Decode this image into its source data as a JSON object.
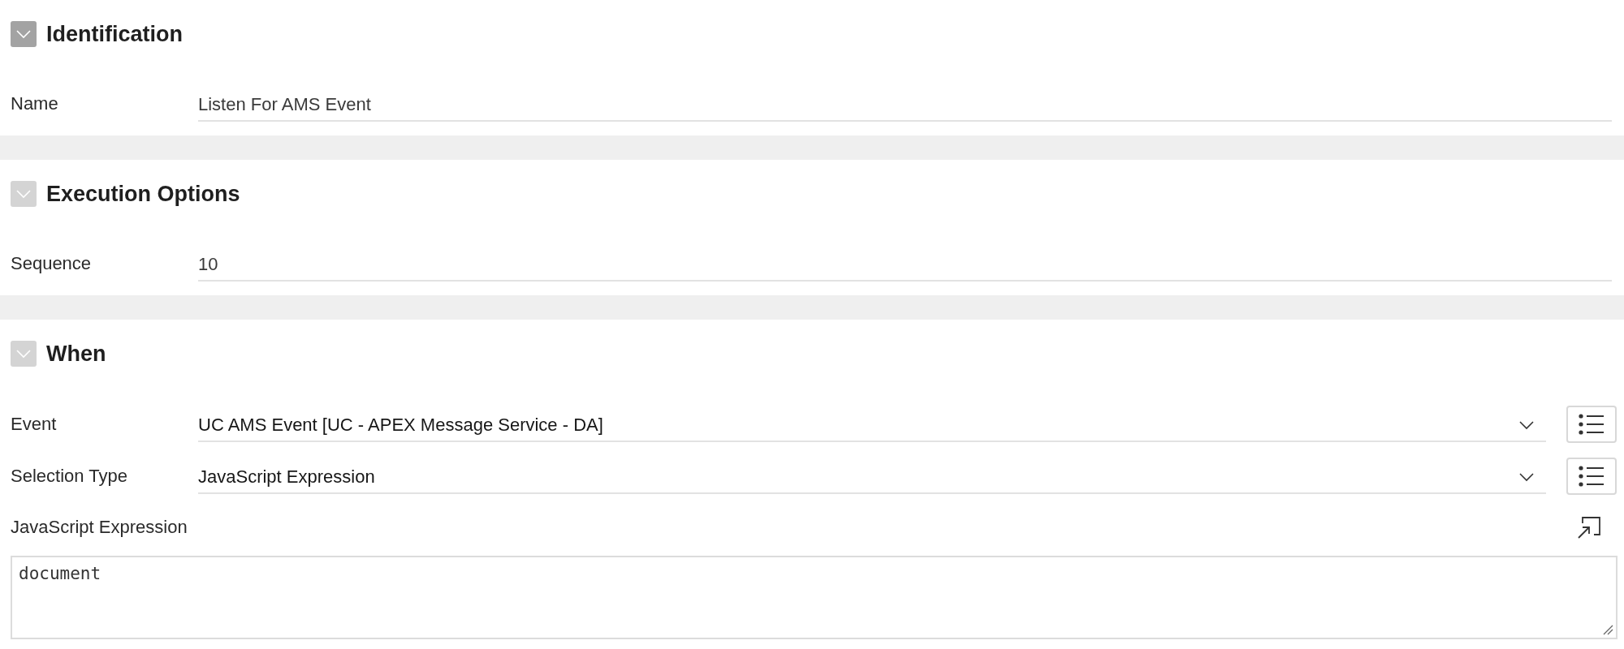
{
  "sections": [
    {
      "title": "Identification",
      "expanded": true,
      "highlighted": true,
      "fields": [
        {
          "kind": "text",
          "label": "Name",
          "value": "Listen For AMS Event"
        }
      ]
    },
    {
      "title": "Execution Options",
      "expanded": true,
      "highlighted": false,
      "fields": [
        {
          "kind": "text",
          "label": "Sequence",
          "value": "10"
        }
      ]
    },
    {
      "title": "When",
      "expanded": true,
      "highlighted": false,
      "fields": [
        {
          "kind": "select",
          "label": "Event",
          "value": "UC AMS Event [UC - APEX Message Service - DA]"
        },
        {
          "kind": "select",
          "label": "Selection Type",
          "value": "JavaScript Expression"
        },
        {
          "kind": "code",
          "label": "JavaScript Expression",
          "value": "document"
        }
      ]
    }
  ]
}
